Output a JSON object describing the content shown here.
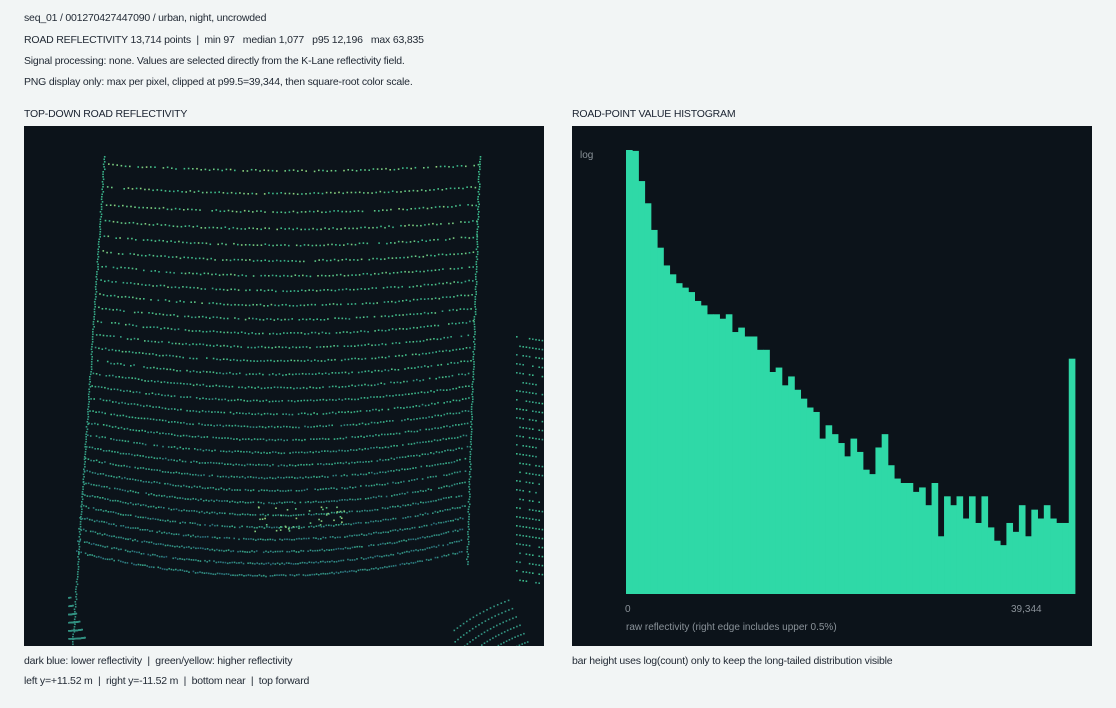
{
  "header": {
    "line1": "seq_01 / 001270427447090 / urban, night, uncrowded",
    "line2": "ROAD REFLECTIVITY 13,714 points  |  min 97   median 1,077   p95 12,196   max 63,835",
    "line3": "Signal processing: none. Values are selected directly from the K-Lane reflectivity field.",
    "line4": "PNG display only: max per pixel, clipped at p99.5=39,344, then square-root color scale."
  },
  "left_panel": {
    "title": "TOP-DOWN ROAD REFLECTIVITY",
    "caption1": "dark blue: lower reflectivity  |  green/yellow: higher reflectivity",
    "caption2": "left y=+11.52 m  |  right y=-11.52 m  |  bottom near  |  top forward"
  },
  "right_panel": {
    "title": "ROAD-POINT VALUE HISTOGRAM",
    "caption": "bar height uses log(count) only to keep the long-tailed distribution visible"
  },
  "colors": {
    "panel_bg": "#0c131a",
    "bar": "#2fd9a7",
    "low": "#2c6b7d",
    "high": "#d8e36a"
  },
  "chart_data": [
    {
      "type": "scatter",
      "title": "TOP-DOWN ROAD REFLECTIVITY",
      "xlim": [
        11.52,
        -11.52
      ],
      "ylabel": "",
      "xlabel": "",
      "note": "road point cloud; color encodes reflectivity"
    },
    {
      "type": "bar",
      "title": "ROAD-POINT VALUE HISTOGRAM",
      "ylabel": "log",
      "xlabel": "raw reflectivity (right edge includes upper 0.5%)",
      "x_ticks": [
        "0",
        "39,344"
      ],
      "xlim": [
        0,
        39344
      ],
      "yscale": "log",
      "bins": 64,
      "values": [
        1.0,
        0.998,
        0.93,
        0.88,
        0.82,
        0.78,
        0.74,
        0.72,
        0.7,
        0.69,
        0.68,
        0.66,
        0.65,
        0.63,
        0.63,
        0.62,
        0.63,
        0.59,
        0.6,
        0.58,
        0.58,
        0.55,
        0.55,
        0.5,
        0.51,
        0.47,
        0.49,
        0.46,
        0.44,
        0.42,
        0.41,
        0.35,
        0.38,
        0.36,
        0.34,
        0.31,
        0.35,
        0.32,
        0.28,
        0.27,
        0.33,
        0.36,
        0.29,
        0.26,
        0.25,
        0.25,
        0.23,
        0.24,
        0.2,
        0.25,
        0.13,
        0.22,
        0.2,
        0.22,
        0.17,
        0.22,
        0.16,
        0.22,
        0.15,
        0.12,
        0.11,
        0.16,
        0.14,
        0.2,
        0.13,
        0.19,
        0.17,
        0.2,
        0.17,
        0.16,
        0.16,
        0.53
      ]
    }
  ]
}
